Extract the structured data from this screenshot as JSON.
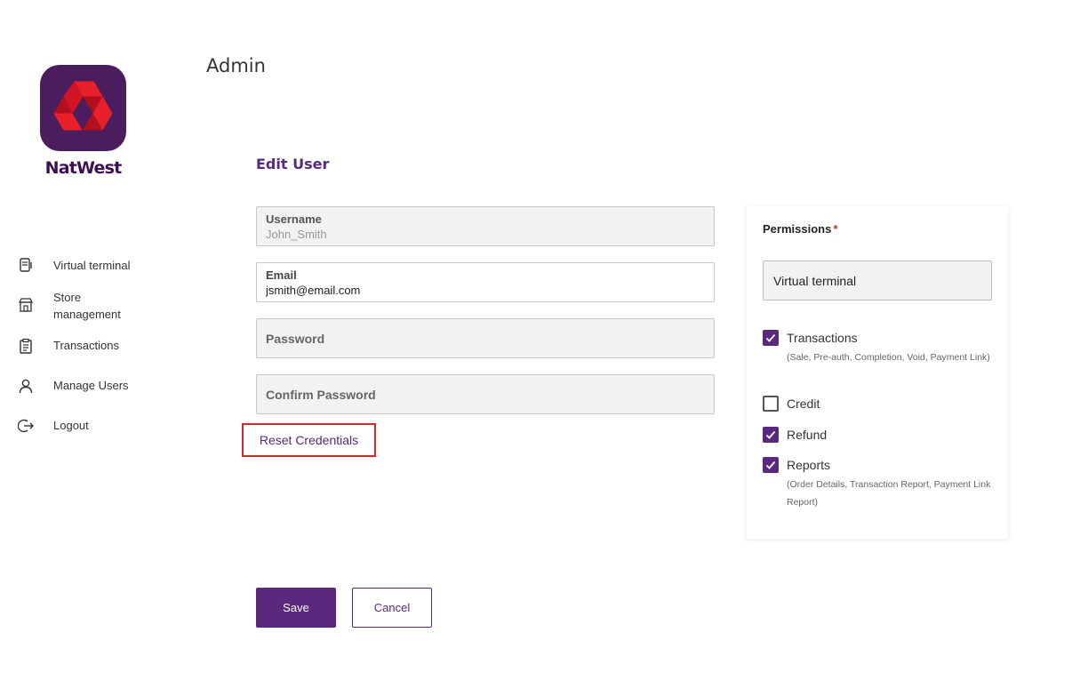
{
  "brand": {
    "name": "NatWest"
  },
  "header": {
    "title": "Admin"
  },
  "sidebar": {
    "items": [
      {
        "label": "Virtual terminal",
        "icon": "terminal-icon"
      },
      {
        "label": "Store management",
        "icon": "store-icon"
      },
      {
        "label": "Transactions",
        "icon": "clipboard-icon"
      },
      {
        "label": "Manage Users",
        "icon": "user-icon"
      },
      {
        "label": "Logout",
        "icon": "logout-icon"
      }
    ]
  },
  "form": {
    "title": "Edit User",
    "username": {
      "label": "Username",
      "value": "John_Smith"
    },
    "email": {
      "label": "Email",
      "value": "jsmith@email.com"
    },
    "password": {
      "placeholder": "Password"
    },
    "confirm_password": {
      "placeholder": "Confirm Password"
    },
    "reset_label": "Reset Credentials",
    "save_label": "Save",
    "cancel_label": "Cancel"
  },
  "permissions": {
    "title": "Permissions",
    "required_mark": "*",
    "selected_role": "Virtual terminal",
    "items": [
      {
        "label": "Transactions",
        "checked": true,
        "description": "(Sale, Pre-auth, Completion, Void, Payment Link)"
      },
      {
        "label": "Credit",
        "checked": false,
        "description": ""
      },
      {
        "label": "Refund",
        "checked": true,
        "description": ""
      },
      {
        "label": "Reports",
        "checked": true,
        "description": "(Order Details, Transaction Report, Payment Link Report)"
      }
    ]
  },
  "colors": {
    "brand_purple": "#5a287d",
    "logo_bg": "#4c1d5c",
    "logo_red": "#e20f1f",
    "highlight_red": "#d9242b"
  }
}
